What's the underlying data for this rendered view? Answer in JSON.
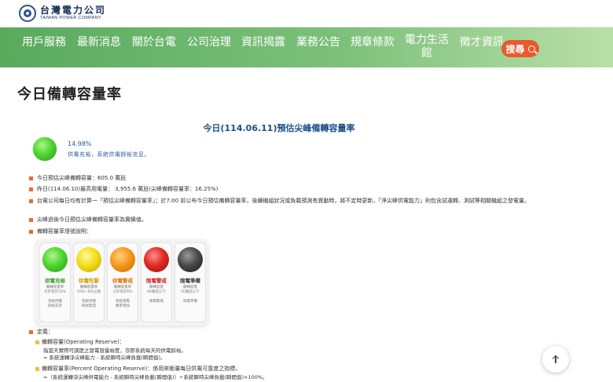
{
  "header": {
    "logo_cn": "台灣電力公司",
    "logo_en": "TAIWAN POWER COMPANY"
  },
  "nav": {
    "items": [
      "用戶服務",
      "最新消息",
      "關於台電",
      "公司治理",
      "資訊揭露",
      "業務公告",
      "規章條款",
      "電力生活館",
      "徵才資訊"
    ],
    "search_label": "搜尋"
  },
  "page": {
    "title": "今日備轉容量率"
  },
  "forecast": {
    "section_title": "今日(114.06.11)預估尖峰備轉容量率",
    "reserve_rate": "14.98%",
    "status_text": "供電充裕，系統供電餘裕充足。",
    "status_color": "#4cd62c"
  },
  "bullets": [
    "今日預估尖峰備轉容量：605.0 萬瓩",
    "昨日(114.06.10)最高用電量： 3,955.6 萬瓩(尖峰備轉容量率：16.25%)",
    "台電公司每日均有計算一「預估尖峰備轉容量率」；於7:00 前公布今日預估備轉容量率，後續機組狀況或負載預測有異動時，將不定時更新，「淨尖峰供電能力」則包含試運轉、測試等相關機組之發電量。",
    "尖峰過後今日預估尖峰備轉容量率為實績值。",
    "備轉容量率燈號說明："
  ],
  "legend_cards": [
    {
      "label": "供電充裕",
      "sub": "備轉容量率\n大於等於10%",
      "foot": "系統供電\n餘裕充足",
      "color": "#4cd62c"
    },
    {
      "label": "供電吃緊",
      "sub": "備轉容量率\n10%~6%之間",
      "foot": "系統供電\n餘裕緊澀",
      "color": "#f4de17"
    },
    {
      "label": "供電警戒",
      "sub": "備轉容量率\n小於等於6%",
      "foot": "系統限電\n機率增加",
      "color": "#f5981e"
    },
    {
      "label": "限電警戒",
      "sub": "備轉容量\n90萬瓩以下",
      "foot": "限電警戒",
      "color": "#e02a24"
    },
    {
      "label": "限電準備",
      "sub": "備轉容量\n50萬瓩以下",
      "foot": "限電準備",
      "color": "#4a4a4a"
    }
  ],
  "definition": {
    "title": "定義：",
    "items": [
      {
        "heading": "備轉容量(Operating Reserve)：",
        "line2": "指當天實際可調度之發電容量裕度，亦即系統每天的供電餘裕。",
        "line3": "= 系統運轉淨尖峰能力 - 系統瞬時尖峰負載(瞬間值)。"
      },
      {
        "heading": "備轉容量率(Percent Operating Reserve)：係用來衡量每日供電可靠度之指標。",
        "line2": "=（系統運轉淨尖峰供電能力 - 系統瞬時尖峰負載(瞬間值)）÷系統瞬時尖峰負載(瞬間值)×100%。"
      }
    ]
  },
  "colors": {
    "nav_green": "#5aaa5e",
    "accent_orange": "#e9592c",
    "title_blue": "#1b4f8a"
  }
}
